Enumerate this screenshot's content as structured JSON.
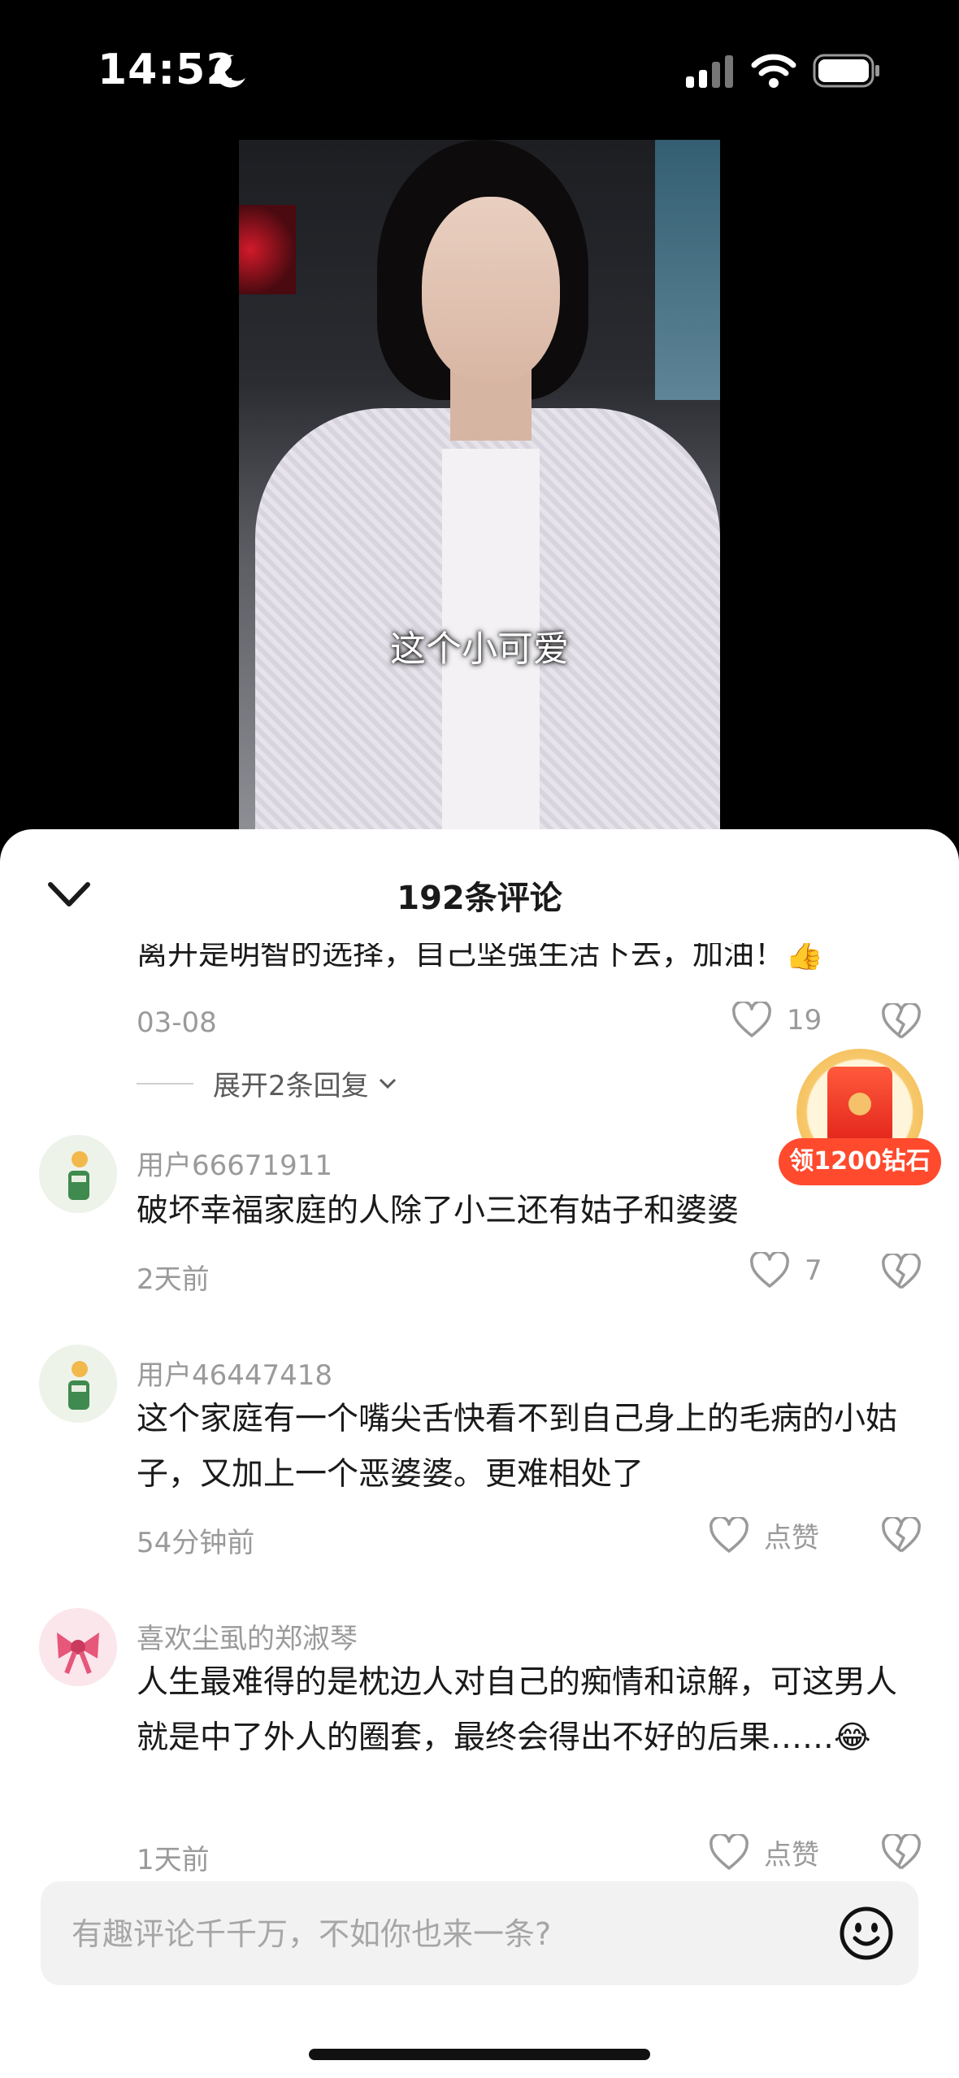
{
  "status_bar": {
    "time": "14:52",
    "icons": [
      "moon-icon",
      "signal-icon",
      "wifi-icon",
      "battery-icon"
    ]
  },
  "video": {
    "subtitle": "这个小可爱"
  },
  "sheet": {
    "title": "192条评论"
  },
  "comments": {
    "partial": {
      "text": "离开是明智的选择，自己坚强生活下去，加油！👍",
      "date": "03-08",
      "likes": "19",
      "expand_label": "展开2条回复"
    },
    "items": [
      {
        "username": "用户66671911",
        "text": "破坏幸福家庭的人除了小三还有姑子和婆婆",
        "time": "2天前",
        "likes": "7"
      },
      {
        "username": "用户46447418",
        "text": "这个家庭有一个嘴尖舌快看不到自己身上的毛病的小姑子，又加上一个恶婆婆。更难相处了",
        "time": "54分钟前",
        "likes": "点赞"
      },
      {
        "username": "喜欢尘虱的郑淑琴",
        "text": "人生最难得的是枕边人对自己的痴情和谅解，可这男人就是中了外人的圈套，最终会得出不好的后果……😂",
        "time": "1天前",
        "likes": "点赞"
      }
    ]
  },
  "reward_badge": {
    "label": "领1200钻石"
  },
  "input": {
    "placeholder": "有趣评论千千万，不如你也来一条?"
  },
  "colors": {
    "accent": "#ff4a2e",
    "muted": "#9a9a9a"
  }
}
